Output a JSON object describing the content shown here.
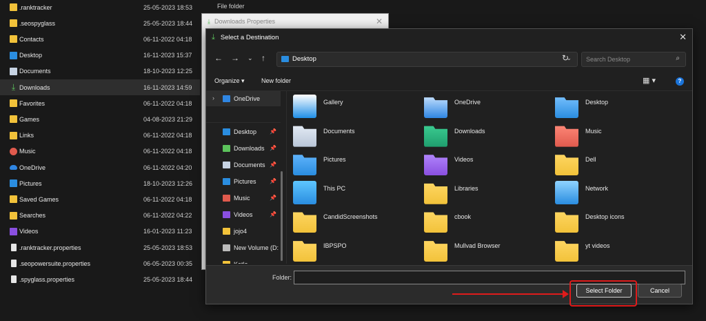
{
  "background_explorer": {
    "rows": [
      {
        "name": ".ranktracker",
        "date": "25-05-2023 18:53",
        "icon": "folder-icon"
      },
      {
        "name": ".seospyglass",
        "date": "25-05-2023 18:44",
        "icon": "folder-icon"
      },
      {
        "name": "Contacts",
        "date": "06-11-2022 04:18",
        "icon": "folder-icon"
      },
      {
        "name": "Desktop",
        "date": "16-11-2023 15:37",
        "icon": "desktop-icon"
      },
      {
        "name": "Documents",
        "date": "18-10-2023 12:25",
        "icon": "documents-icon"
      },
      {
        "name": "Downloads",
        "date": "16-11-2023 14:59",
        "icon": "downloads-icon"
      },
      {
        "name": "Favorites",
        "date": "06-11-2022 04:18",
        "icon": "folder-icon"
      },
      {
        "name": "Games",
        "date": "04-08-2023 21:29",
        "icon": "folder-icon"
      },
      {
        "name": "Links",
        "date": "06-11-2022 04:18",
        "icon": "folder-icon"
      },
      {
        "name": "Music",
        "date": "06-11-2022 04:18",
        "icon": "music-icon"
      },
      {
        "name": "OneDrive",
        "date": "06-11-2022 04:20",
        "icon": "onedrive-icon"
      },
      {
        "name": "Pictures",
        "date": "18-10-2023 12:26",
        "icon": "pictures-icon"
      },
      {
        "name": "Saved Games",
        "date": "06-11-2022 04:18",
        "icon": "folder-icon"
      },
      {
        "name": "Searches",
        "date": "06-11-2022 04:22",
        "icon": "folder-icon"
      },
      {
        "name": "Videos",
        "date": "16-01-2023 11:23",
        "icon": "videos-icon"
      },
      {
        "name": ".ranktracker.properties",
        "date": "25-05-2023 18:53",
        "icon": "file-icon"
      },
      {
        "name": ".seopowersuite.properties",
        "date": "06-05-2023 00:35",
        "icon": "file-icon"
      },
      {
        "name": ".spyglass.properties",
        "date": "25-05-2023 18:44",
        "icon": "file-icon"
      }
    ],
    "type_column": "File folder"
  },
  "properties_window": {
    "title": "Downloads Properties"
  },
  "dialog": {
    "title": "Select a Destination",
    "address": "Desktop",
    "search_placeholder": "Search Desktop",
    "organize_label": "Organize",
    "new_folder_label": "New folder",
    "nav": [
      {
        "label": "OneDrive",
        "pinned": false
      },
      {
        "label": "Desktop",
        "pinned": true
      },
      {
        "label": "Downloads",
        "pinned": true
      },
      {
        "label": "Documents",
        "pinned": true
      },
      {
        "label": "Pictures",
        "pinned": true
      },
      {
        "label": "Music",
        "pinned": true
      },
      {
        "label": "Videos",
        "pinned": true
      },
      {
        "label": "jojo4",
        "pinned": false
      },
      {
        "label": "New Volume (D:",
        "pinned": false
      },
      {
        "label": "Katla",
        "pinned": false
      }
    ],
    "items": [
      {
        "label": "Gallery",
        "icon": "gallery-icon"
      },
      {
        "label": "OneDrive",
        "icon": "onedrive-folder-icon"
      },
      {
        "label": "Desktop",
        "icon": "desktop-folder-icon"
      },
      {
        "label": "Documents",
        "icon": "documents-folder-icon"
      },
      {
        "label": "Downloads",
        "icon": "downloads-folder-icon"
      },
      {
        "label": "Music",
        "icon": "music-folder-icon"
      },
      {
        "label": "Pictures",
        "icon": "pictures-folder-icon"
      },
      {
        "label": "Videos",
        "icon": "videos-folder-icon"
      },
      {
        "label": "Dell",
        "icon": "folder-icon"
      },
      {
        "label": "This PC",
        "icon": "this-pc-icon"
      },
      {
        "label": "Libraries",
        "icon": "libraries-icon"
      },
      {
        "label": "Network",
        "icon": "network-icon"
      },
      {
        "label": "CandidScreenshots",
        "icon": "folder-icon"
      },
      {
        "label": "cbook",
        "icon": "folder-icon"
      },
      {
        "label": "Desktop icons",
        "icon": "folder-icon"
      },
      {
        "label": "IBPSPO",
        "icon": "folder-icon"
      },
      {
        "label": "Mullvad Browser",
        "icon": "folder-icon"
      },
      {
        "label": "yt videos",
        "icon": "folder-icon"
      }
    ],
    "folder_label": "Folder:",
    "folder_value": "",
    "select_button": "Select Folder",
    "cancel_button": "Cancel"
  },
  "colors": {
    "accent": "#1a73d9",
    "annotation": "#e01b1b",
    "folder": "#f2c23a"
  }
}
